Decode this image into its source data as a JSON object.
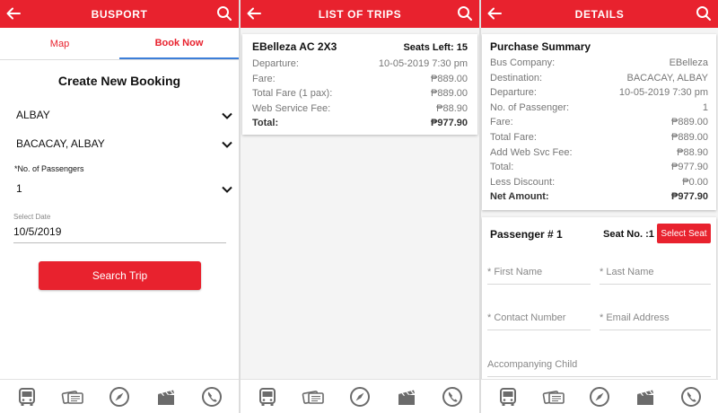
{
  "screens": {
    "busport": {
      "title": "BUSPORT",
      "tabs": [
        "Map",
        "Book Now"
      ],
      "heading": "Create New Booking",
      "origin": "ALBAY",
      "destination": "BACACAY, ALBAY",
      "passengers_label": "*No. of Passengers",
      "passengers_value": "1",
      "date_label": "Select Date",
      "date_value": "10/5/2019",
      "search_button": "Search Trip"
    },
    "trips": {
      "title": "LIST OF TRIPS",
      "trip": {
        "name": "EBelleza AC 2X3",
        "seats_left": "Seats Left: 15",
        "rows": [
          {
            "label": "Departure:",
            "value": "10-05-2019 7:30 pm"
          },
          {
            "label": "Fare:",
            "value": "₱889.00"
          },
          {
            "label": "Total Fare (1 pax):",
            "value": "₱889.00"
          },
          {
            "label": "Web Service Fee:",
            "value": "₱88.90"
          },
          {
            "label": "Total:",
            "value": "₱977.90"
          }
        ]
      }
    },
    "details": {
      "title": "DETAILS",
      "summary_title": "Purchase Summary",
      "rows": [
        {
          "label": "Bus Company:",
          "value": "EBelleza"
        },
        {
          "label": "Destination:",
          "value": "BACACAY, ALBAY"
        },
        {
          "label": "Departure:",
          "value": "10-05-2019 7:30 pm"
        },
        {
          "label": "No. of Passenger:",
          "value": "1"
        },
        {
          "label": "Fare:",
          "value": "₱889.00"
        },
        {
          "label": "Total Fare:",
          "value": "₱889.00"
        },
        {
          "label": "Add Web Svc Fee:",
          "value": "₱88.90"
        },
        {
          "label": "Total:",
          "value": "₱977.90"
        },
        {
          "label": "Less Discount:",
          "value": "₱0.00"
        },
        {
          "label": "Net Amount:",
          "value": "₱977.90"
        }
      ],
      "passenger_title": "Passenger # 1",
      "seat_no": "Seat No. :1",
      "select_seat": "Select Seat",
      "first_name": "* First Name",
      "last_name": "* Last Name",
      "contact_number": "* Contact Number",
      "email": "* Email Address",
      "accompanying_child": "Accompanying Child"
    }
  },
  "nav_icons": [
    "bus-icon",
    "tickets-icon",
    "compass-icon",
    "clapperboard-icon",
    "phone-icon"
  ],
  "colors": {
    "accent": "#e8222e",
    "tab_indicator": "#3c7ed8",
    "nav_icon": "#6b6b6b"
  }
}
